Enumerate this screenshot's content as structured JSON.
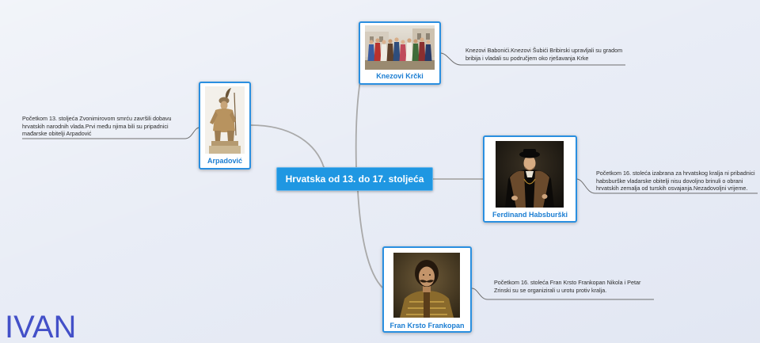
{
  "central_topic": {
    "label": "Hrvatska od 13. do 17. stoljeća"
  },
  "topics": [
    {
      "label": "Knezovi Krčki",
      "note_lines": [
        "Knezovi Babonići.Knezovi Šubići Bribirski upravljali su gradom",
        "bribija i vladali su područjem oko rješavanja Krke"
      ]
    },
    {
      "label": "Arpadović",
      "note_lines": [
        "Početkom 13. stoljeća Zvonimirovom smrću završili dobavu",
        "hrvatskih narodnih vlada.Prvi među njima bili su pripadnici",
        "mađarske obitelji Arpadović"
      ]
    },
    {
      "label": "Ferdinand Habsburški",
      "note_lines": [
        "Početkom 16. stoleća izabrana za hrvatskog kralja ni pribadnici",
        "habsburške vladarske obitelji nisu dovoljno brinuli o obrani",
        "hrvatskih zemalja od turskih osvajanja.Nezadovoljni vrijeme."
      ]
    },
    {
      "label": "Fran Krsto Frankopan",
      "note_lines": [
        "Početkom 16. stoleća Fran Krsto Frankopan Nikola i Petar",
        "Zrinski su se organizirali u urotu protiv kralja."
      ]
    }
  ],
  "signature": "IVAN",
  "colors": {
    "background": "#e9edf6",
    "central_fill": "#1f97e2",
    "node_border": "#2a8fe0",
    "node_label": "#1a7dd2",
    "connector": "#a9a9a9",
    "note_line": "#6f6f6f",
    "note_text": "#2a2a2a",
    "signature": "#4350c8"
  }
}
